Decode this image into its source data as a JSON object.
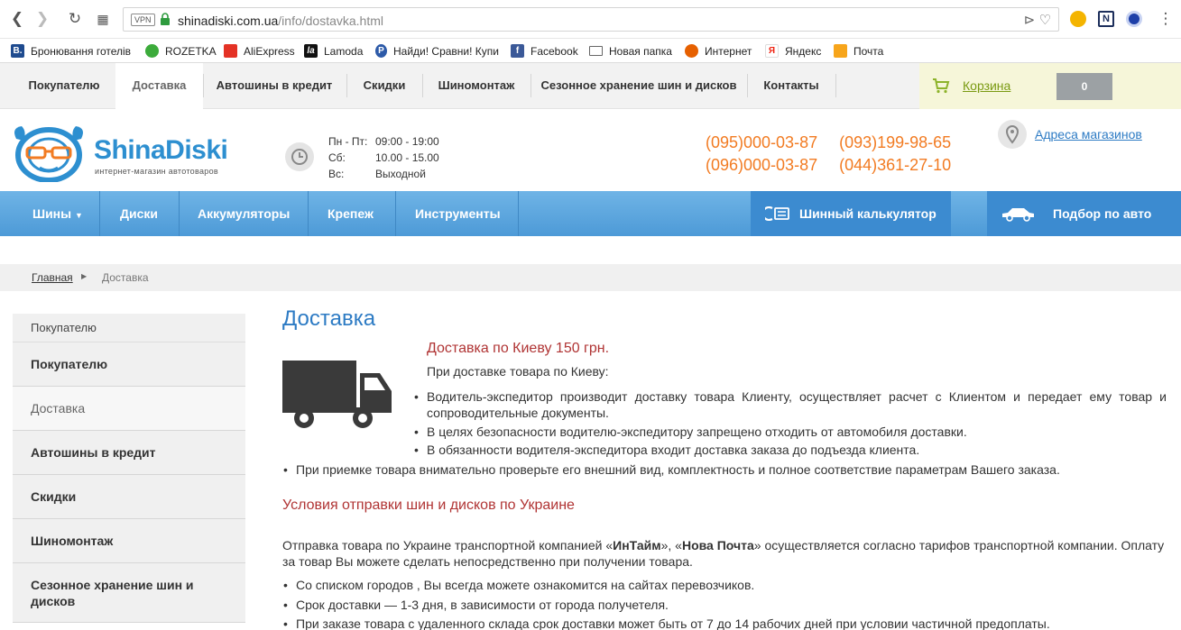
{
  "browser": {
    "vpn_label": "VPN",
    "url_host": "shinadiski.com.ua",
    "url_path": "/info/dostavka.html",
    "bookmarks": [
      {
        "label": "Бронювання готелів",
        "icon": "booking-icon",
        "color": "#1f4b8f",
        "glyph": "B."
      },
      {
        "label": "ROZETKA",
        "icon": "rozetka-icon",
        "color": "#3cab3b",
        "glyph": ""
      },
      {
        "label": "AliExpress",
        "icon": "aliexpress-icon",
        "color": "#e43225",
        "glyph": ""
      },
      {
        "label": "Lamoda",
        "icon": "lamoda-icon",
        "color": "#111111",
        "glyph": "la"
      },
      {
        "label": "Найди! Сравни! Купи",
        "icon": "price-ua-icon",
        "color": "#2d5aa8",
        "glyph": "P"
      },
      {
        "label": "Facebook",
        "icon": "facebook-icon",
        "color": "#3b5998",
        "glyph": "f"
      },
      {
        "label": "Новая папка",
        "icon": "folder-icon",
        "color": "#ffffff",
        "glyph": ""
      },
      {
        "label": "Интернет",
        "icon": "firefox-icon",
        "color": "#e66000",
        "glyph": ""
      },
      {
        "label": "Яндекс",
        "icon": "yandex-icon",
        "color": "#ffffff",
        "glyph": "Я"
      },
      {
        "label": "Почта",
        "icon": "mail-icon",
        "color": "#f7a51b",
        "glyph": ""
      }
    ]
  },
  "top_menu": {
    "items": [
      "Покупателю",
      "Доставка",
      "Автошины в кредит",
      "Скидки",
      "Шиномонтаж",
      "Сезонное хранение шин и дисков",
      "Контакты"
    ],
    "active_index": 1,
    "cart_label": "Корзина",
    "cart_count": "0"
  },
  "header": {
    "logo_text": "ShinaDiski",
    "logo_sub": "интернет-магазин автотоваров",
    "hours": [
      {
        "day": "Пн - Пт:",
        "time": "09:00 - 19:00"
      },
      {
        "day": "Сб:",
        "time": "10.00 - 15.00"
      },
      {
        "day": "Вс:",
        "time": "Выходной"
      }
    ],
    "phones": [
      "(095)000-03-87",
      "(093)199-98-65",
      "(096)000-03-87",
      "(044)361-27-10"
    ],
    "stores_link": "Адреса магазинов"
  },
  "main_nav": {
    "items": [
      "Шины",
      "Диски",
      "Аккумуляторы",
      "Крепеж",
      "Инструменты"
    ],
    "calculator": "Шинный калькулятор",
    "car_select": "Подбор по авто"
  },
  "breadcrumb": {
    "home": "Главная",
    "current": "Доставка"
  },
  "sidebar": {
    "title": "Покупателю",
    "items": [
      "Покупателю",
      "Доставка",
      "Автошины в кредит",
      "Скидки",
      "Шиномонтаж",
      "Сезонное хранение шин и дисков"
    ],
    "active_index": 1
  },
  "content": {
    "title": "Доставка",
    "kyiv_heading": "Доставка по Киеву  150 грн.",
    "kyiv_intro": "При доставке товара по Киеву:",
    "kyiv_bullets": [
      "Водитель-экспедитор производит доставку товара Клиенту, осуществляет расчет с Клиентом и передает ему товар и сопроводительные документы.",
      "В целях безопасности водителю-экспедитору запрещено отходить от автомобиля доставки.",
      "В обязанности водителя-экспедитора входит доставка заказа до подъезда клиента."
    ],
    "general_bullet": "При приемке товара внимательно проверьте его внешний вид, комплектность и полное соответствие параметрам Вашего заказа.",
    "ukraine_heading": "Условия отправки шин и дисков по Украине",
    "ukraine_para_start": "Отправка товара по Украине транспортной компанией «",
    "carrier_1": "ИнТайм",
    "ukraine_para_mid": "», «",
    "carrier_2": "Нова Почта",
    "ukraine_para_end": "» осуществляется согласно тарифов транспортной компании.  Оплату за товар Вы можете сделать непосредственно при получении товара.",
    "ukraine_bullets": [
      "Со списком городов , Вы всегда можете ознакомится на сайтах перевозчиков.",
      "Срок доставки — 1-3 дня, в зависимости от города получетеля.",
      "При заказе товара с удаленного склада срок доставки может быть от 7 до 14 рабочих дней при условии частичной предоплаты."
    ]
  }
}
